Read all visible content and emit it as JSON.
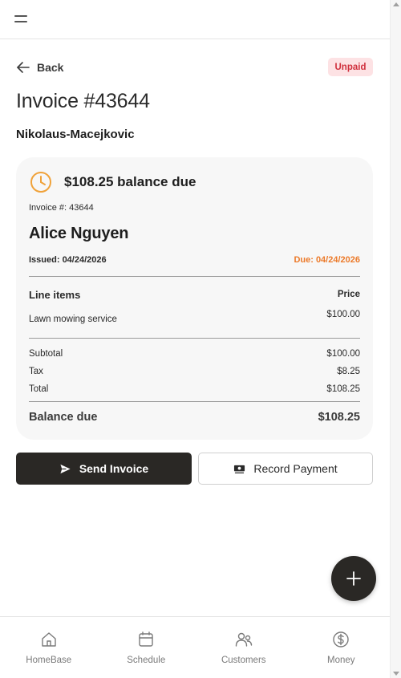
{
  "header": {
    "menu_icon": "hamburger-menu-icon"
  },
  "nav": {
    "back_label": "Back",
    "back_icon": "arrow-left-icon"
  },
  "status": {
    "label": "Unpaid",
    "bg": "#fde2e4",
    "color": "#d0303d"
  },
  "invoice": {
    "title": "Invoice #43644",
    "company": "Nikolaus-Macejkovic",
    "balance_heading": "$108.25 balance due",
    "clock_icon": "clock-icon",
    "number_label": "Invoice #:",
    "number_value": "43644",
    "customer": "Alice Nguyen",
    "issued": "Issued: 04/24/2026",
    "due": "Due: 04/24/2026",
    "due_color": "#ec7a2a",
    "line_items_header": "Line items",
    "price_header": "Price",
    "line_items": [
      {
        "name": "Lawn mowing service",
        "price": "$100.00"
      }
    ],
    "subtotal_label": "Subtotal",
    "subtotal_value": "$100.00",
    "tax_label": "Tax",
    "tax_value": "$8.25",
    "total_label": "Total",
    "total_value": "$108.25",
    "balance_label": "Balance due",
    "balance_value": "$108.25"
  },
  "actions": {
    "send_label": "Send Invoice",
    "send_icon": "send-icon",
    "record_label": "Record Payment",
    "record_icon": "payment-icon",
    "fab_icon": "plus-icon"
  },
  "bottom_nav": [
    {
      "label": "HomeBase",
      "icon": "home-icon"
    },
    {
      "label": "Schedule",
      "icon": "calendar-icon"
    },
    {
      "label": "Customers",
      "icon": "customers-icon"
    },
    {
      "label": "Money",
      "icon": "dollar-icon"
    }
  ],
  "colors": {
    "primary_dark": "#2a2825",
    "card_bg": "#f7f7f7"
  }
}
